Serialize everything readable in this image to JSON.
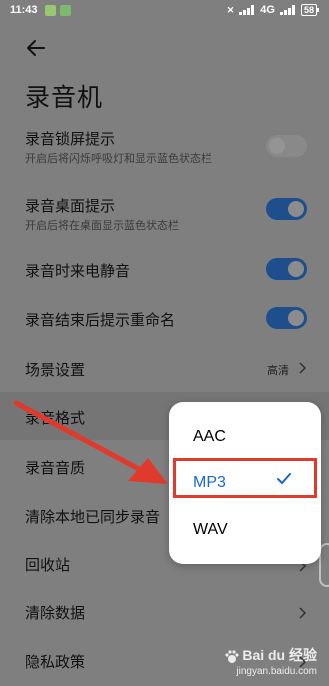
{
  "status_bar": {
    "time": "11:43",
    "network": "4G",
    "battery": "58"
  },
  "header": {
    "title": "录音机"
  },
  "settings": {
    "lock_screen": {
      "label": "录音锁屏提示",
      "sub": "开启后将闪烁呼吸灯和显示蓝色状态栏",
      "enabled": false
    },
    "desktop_tip": {
      "label": "录音桌面提示",
      "sub": "开启后将在桌面显示蓝色状态栏",
      "enabled": true
    },
    "mute_calls": {
      "label": "录音时来电静音",
      "enabled": true
    },
    "rename_tip": {
      "label": "录音结束后提示重命名",
      "enabled": true
    },
    "scene": {
      "label": "场景设置",
      "value": "高清"
    },
    "format": {
      "label": "录音格式"
    },
    "quality": {
      "label": "录音音质"
    },
    "clear_synced": {
      "label": "清除本地已同步录音"
    },
    "recycle_bin": {
      "label": "回收站"
    },
    "clear_data": {
      "label": "清除数据"
    },
    "privacy": {
      "label": "隐私政策"
    }
  },
  "format_popup": {
    "options": [
      "AAC",
      "MP3",
      "WAV"
    ],
    "selected": "MP3"
  },
  "watermark": {
    "brand": "Bai du 经验",
    "url": "jingyan.baidu.com"
  },
  "colors": {
    "accent": "#1a67d6",
    "annotation": "#e03a2d"
  }
}
